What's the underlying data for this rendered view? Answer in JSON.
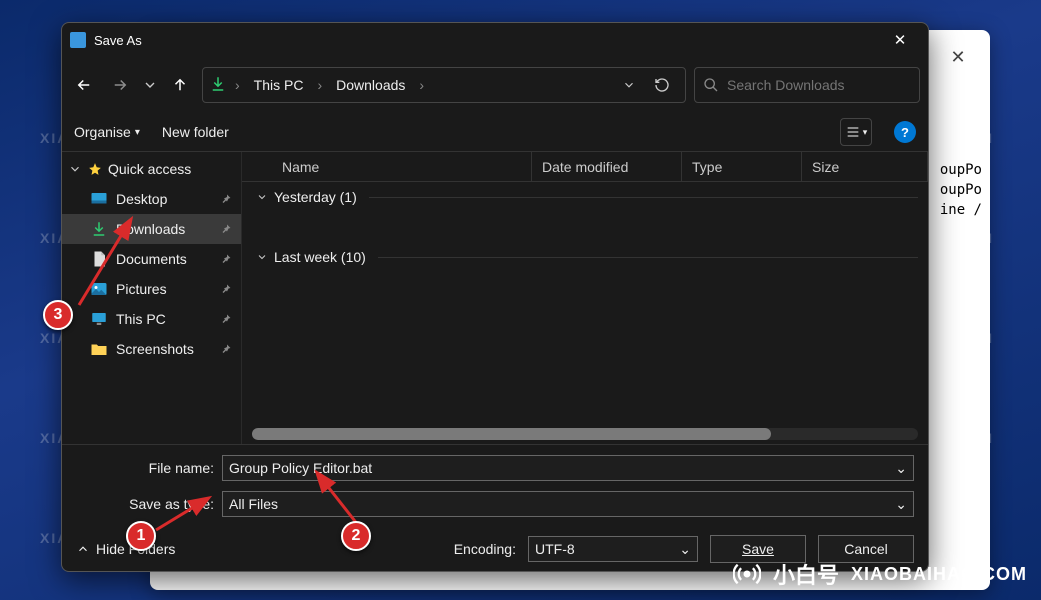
{
  "dialog": {
    "title": "Save As",
    "nav": {
      "crumb1": "This PC",
      "crumb2": "Downloads"
    },
    "search": {
      "placeholder": "Search Downloads"
    },
    "toolbar": {
      "organise": "Organise",
      "new_folder": "New folder"
    },
    "sidebar": {
      "quick_access": "Quick access",
      "items": [
        {
          "label": "Desktop",
          "icon": "desktop"
        },
        {
          "label": "Downloads",
          "icon": "downloads"
        },
        {
          "label": "Documents",
          "icon": "documents"
        },
        {
          "label": "Pictures",
          "icon": "pictures"
        },
        {
          "label": "This PC",
          "icon": "pc"
        },
        {
          "label": "Screenshots",
          "icon": "folder"
        }
      ]
    },
    "columns": {
      "name": "Name",
      "date": "Date modified",
      "type": "Type",
      "size": "Size"
    },
    "groups": {
      "g0": "Yesterday (1)",
      "g1": "Last week (10)"
    },
    "file_name_label": "File name:",
    "file_name_value": "Group Policy Editor.bat",
    "save_type_label": "Save as type:",
    "save_type_value": "All Files",
    "hide_folders": "Hide Folders",
    "encoding_label": "Encoding:",
    "encoding_value": "UTF-8",
    "save": "Save",
    "cancel": "Cancel"
  },
  "bg_text": {
    "l1": "oupPo",
    "l2": "oupPo",
    "l3": "ine  /"
  },
  "badges": {
    "b1": "1",
    "b2": "2",
    "b3": "3"
  },
  "brand": {
    "cn": "小白号",
    "url": "XIAOBAIHAO.COM"
  },
  "watermark": "XIAOBAIHAO.COM"
}
